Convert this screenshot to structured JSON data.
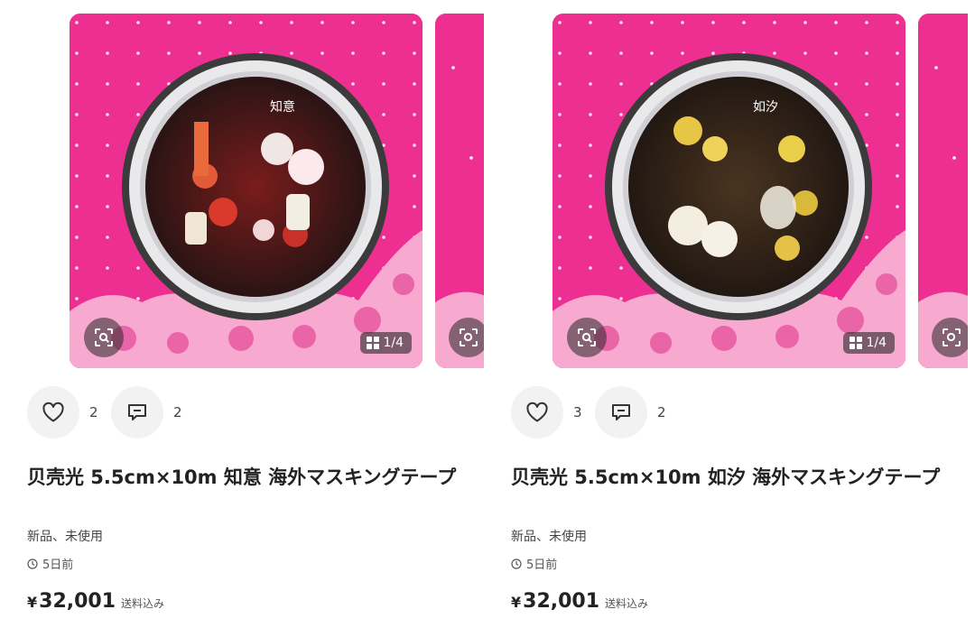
{
  "colors": {
    "accent_pink": "#ee2f92",
    "overlay": "#2a2a2a"
  },
  "listings": [
    {
      "image_counter": "1/4",
      "likes": "2",
      "comments": "2",
      "title": "贝壳光 5.5cm×10m 知意 海外マスキングテープ",
      "condition": "新品、未使用",
      "posted": "5日前",
      "currency": "¥",
      "price": "32,001",
      "shipping": "送料込み",
      "tape_label": "知意"
    },
    {
      "image_counter": "1/4",
      "likes": "3",
      "comments": "2",
      "title": "贝壳光 5.5cm×10m 如汐 海外マスキングテープ",
      "condition": "新品、未使用",
      "posted": "5日前",
      "currency": "¥",
      "price": "32,001",
      "shipping": "送料込み",
      "tape_label": "如汐"
    }
  ]
}
